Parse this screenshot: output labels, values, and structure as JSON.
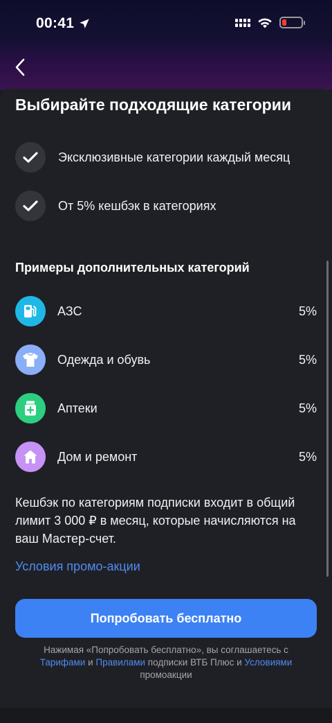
{
  "status_bar": {
    "time": "00:41"
  },
  "header": {
    "back_icon": "chevron-left-icon"
  },
  "title": "Выбирайте подходящие категории",
  "features": [
    {
      "text": "Эксклюзивные категории каждый месяц",
      "icon": "check-icon"
    },
    {
      "text": "От 5% кешбэк в категориях",
      "icon": "check-icon"
    }
  ],
  "section_title": "Примеры дополнительных категорий",
  "categories": [
    {
      "label": "АЗС",
      "value": "5%",
      "icon": "fuel-pump-icon",
      "color": "#1fb8e6"
    },
    {
      "label": "Одежда и обувь",
      "value": "5%",
      "icon": "tshirt-icon",
      "color": "#8aaef7"
    },
    {
      "label": "Аптеки",
      "value": "5%",
      "icon": "medicine-icon",
      "color": "#2ccf7f"
    },
    {
      "label": "Дом и ремонт",
      "value": "5%",
      "icon": "house-icon",
      "color": "#c792f5"
    }
  ],
  "note": "Кешбэк по категориям подписки входит в общий лимит 3 000 ₽ в месяц, которые начисляются на ваш Мастер-счет.",
  "promo_link": "Условия промо-акции",
  "cta_label": "Попробовать бесплатно",
  "legal": {
    "part1": "Нажимая «Попробовать бесплатно», вы соглашаетесь с ",
    "link_tariffs": "Тарифами",
    "part2": " и ",
    "link_rules": "Правилами",
    "part3": " подписки ВТБ Плюс и ",
    "link_conditions": "Условиями",
    "part4": " промоакции"
  },
  "colors": {
    "accent": "#3d82f5",
    "link": "#4f8bf0",
    "background": "#1f2025"
  }
}
